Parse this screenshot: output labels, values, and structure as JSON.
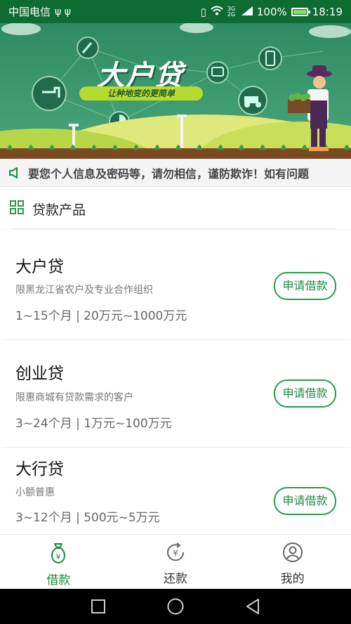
{
  "status_bar": {
    "carrier": "中国电信",
    "network": "3G 2G",
    "battery": "100%",
    "time": "18:19"
  },
  "banner": {
    "title": "大户贷",
    "subtitle": "让种地变的更简单"
  },
  "notice": {
    "text": "要您个人信息及密码等，请勿相信，谨防欺诈！如有问题"
  },
  "section": {
    "title": "贷款产品"
  },
  "products": [
    {
      "name": "大户贷",
      "desc": "限黑龙江省农户及专业合作组织",
      "terms": "1~15个月 | 20万元~1000万元",
      "button": "申请借款"
    },
    {
      "name": "创业贷",
      "desc": "限惠商城有贷款需求的客户",
      "terms": "3~24个月 | 1万元~100万元",
      "button": "申请借款"
    },
    {
      "name": "大行贷",
      "desc": "小额普惠",
      "terms": "3~12个月 | 500元~5万元",
      "button": "申请借款"
    }
  ],
  "tabs": [
    {
      "label": "借款",
      "icon": "money-bag-icon",
      "active": true
    },
    {
      "label": "还款",
      "icon": "repay-icon",
      "active": false
    },
    {
      "label": "我的",
      "icon": "user-icon",
      "active": false
    }
  ],
  "colors": {
    "primary": "#1c8a3a",
    "status_bar": "#0e6b32",
    "button_border": "#2a9d4a"
  }
}
